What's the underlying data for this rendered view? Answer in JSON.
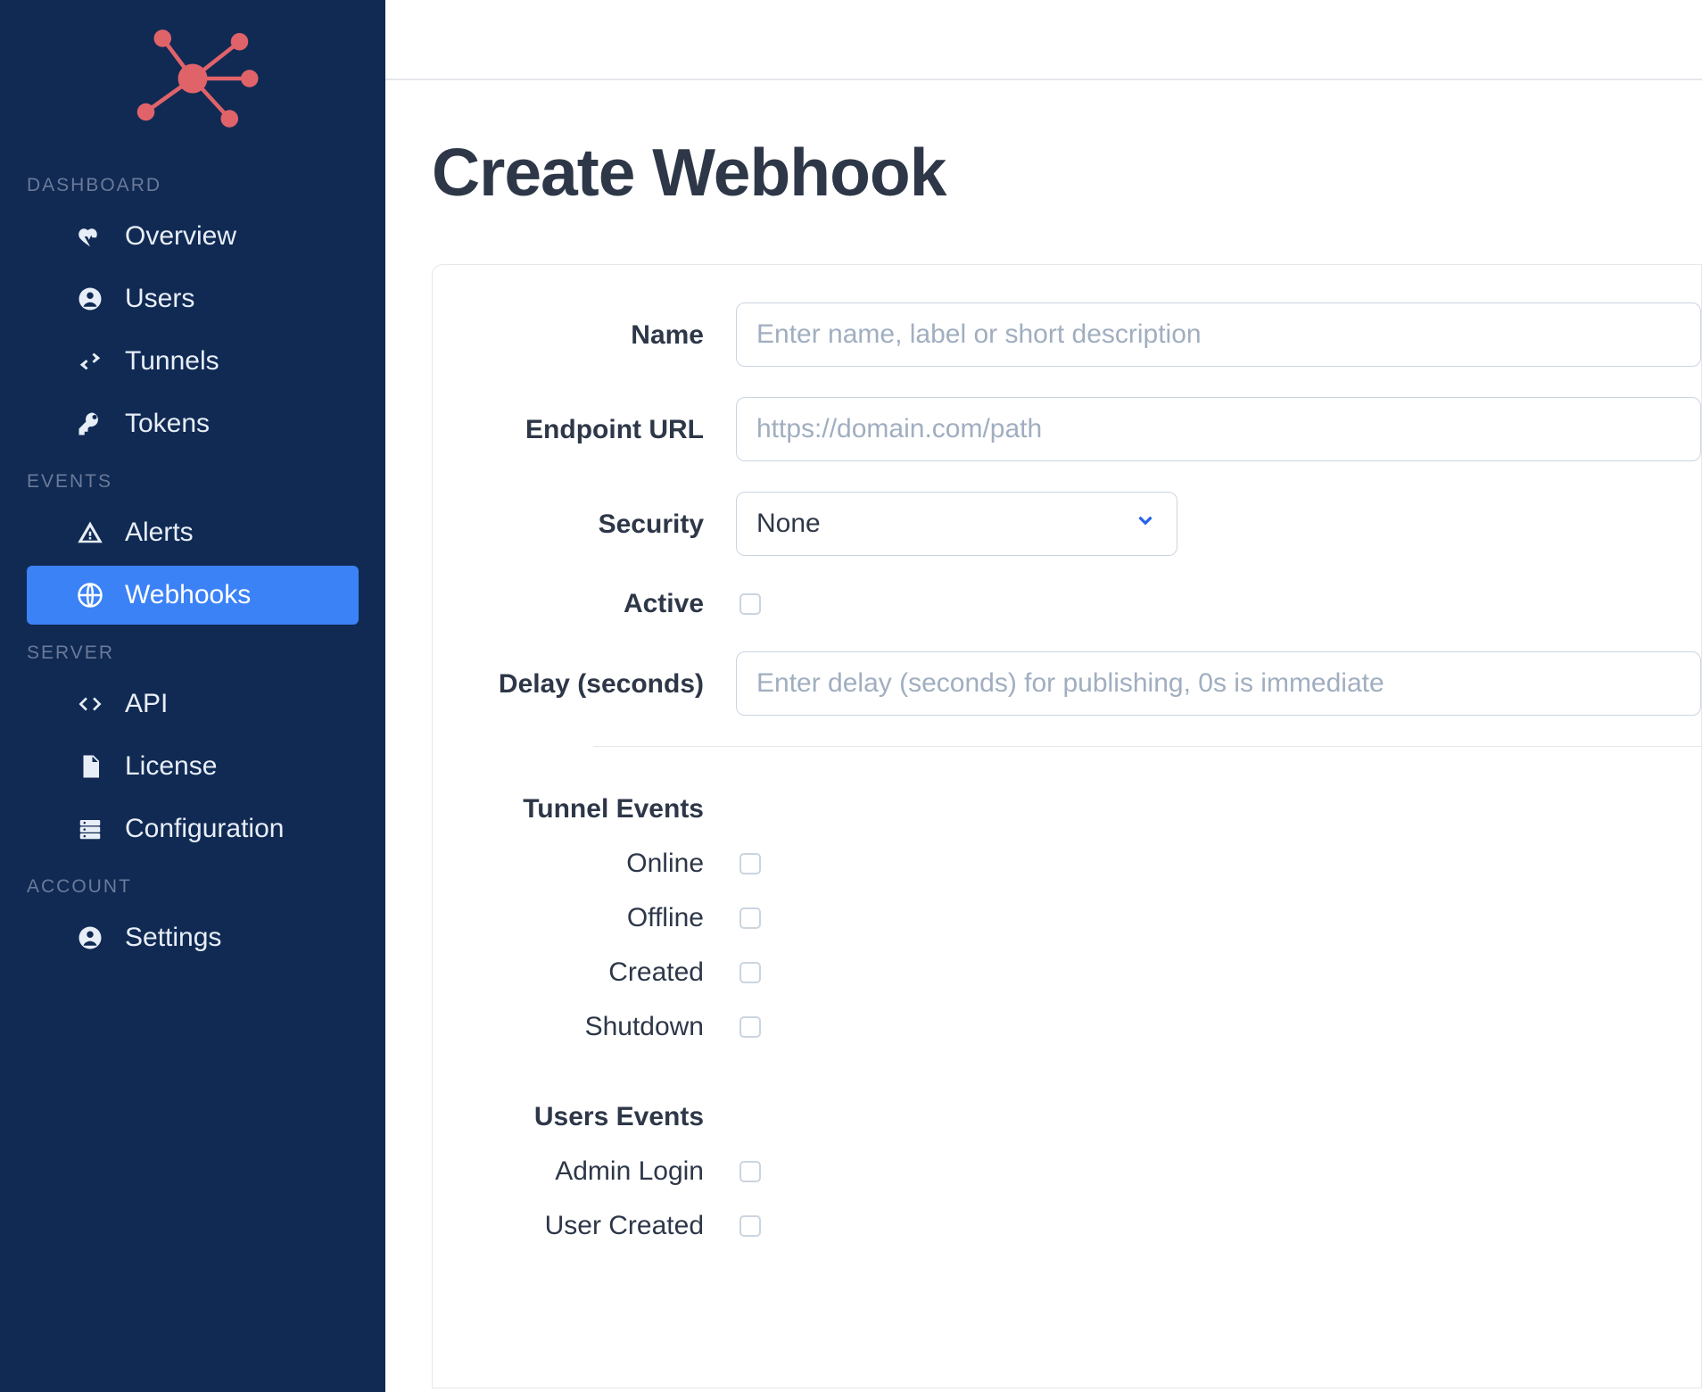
{
  "sidebar": {
    "sections": [
      {
        "title": "DASHBOARD",
        "items": [
          {
            "label": "Overview",
            "icon": "heartbeat-icon"
          },
          {
            "label": "Users",
            "icon": "user-circle-icon"
          },
          {
            "label": "Tunnels",
            "icon": "swap-icon"
          },
          {
            "label": "Tokens",
            "icon": "key-icon"
          }
        ]
      },
      {
        "title": "EVENTS",
        "items": [
          {
            "label": "Alerts",
            "icon": "alert-icon"
          },
          {
            "label": "Webhooks",
            "icon": "globe-icon",
            "active": true
          }
        ]
      },
      {
        "title": "SERVER",
        "items": [
          {
            "label": "API",
            "icon": "code-icon"
          },
          {
            "label": "License",
            "icon": "document-icon"
          },
          {
            "label": "Configuration",
            "icon": "server-icon"
          }
        ]
      },
      {
        "title": "ACCOUNT",
        "items": [
          {
            "label": "Settings",
            "icon": "user-circle-icon"
          }
        ]
      }
    ]
  },
  "page": {
    "title": "Create Webhook"
  },
  "form": {
    "name": {
      "label": "Name",
      "placeholder": "Enter name, label or short description",
      "value": ""
    },
    "endpoint": {
      "label": "Endpoint URL",
      "placeholder": "https://domain.com/path",
      "value": ""
    },
    "security": {
      "label": "Security",
      "selected": "None"
    },
    "active": {
      "label": "Active",
      "checked": false
    },
    "delay": {
      "label": "Delay (seconds)",
      "placeholder": "Enter delay (seconds) for publishing, 0s is immediate",
      "value": ""
    }
  },
  "tunnel_events": {
    "title": "Tunnel Events",
    "items": [
      {
        "label": "Online",
        "checked": false
      },
      {
        "label": "Offline",
        "checked": false
      },
      {
        "label": "Created",
        "checked": false
      },
      {
        "label": "Shutdown",
        "checked": false
      }
    ]
  },
  "users_events": {
    "title": "Users Events",
    "items": [
      {
        "label": "Admin Login",
        "checked": false
      },
      {
        "label": "User Created",
        "checked": false
      }
    ]
  }
}
